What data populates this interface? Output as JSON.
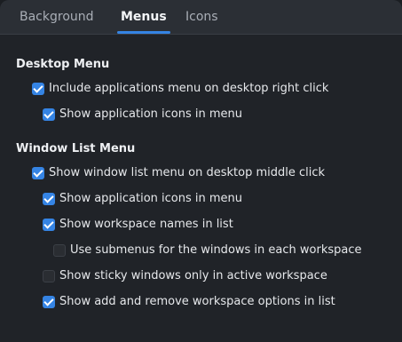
{
  "tabs": [
    "Background",
    "Menus",
    "Icons"
  ],
  "active_tab": "Menus",
  "accent_color": "#3584e4",
  "desktop_menu": {
    "title": "Desktop Menu",
    "options": [
      {
        "label": "Include applications menu on desktop right click",
        "checked": true
      },
      {
        "label": "Show application icons in menu",
        "checked": true
      }
    ]
  },
  "window_list_menu": {
    "title": "Window List Menu",
    "options": [
      {
        "label": "Show window list menu on desktop middle click",
        "checked": true
      },
      {
        "label": "Show application icons in menu",
        "checked": true
      },
      {
        "label": "Show workspace names in list",
        "checked": true
      },
      {
        "label": "Use submenus for the windows in each workspace",
        "checked": false
      },
      {
        "label": "Show sticky windows only in active workspace",
        "checked": false
      },
      {
        "label": "Show add and remove workspace options in list",
        "checked": true
      }
    ]
  }
}
